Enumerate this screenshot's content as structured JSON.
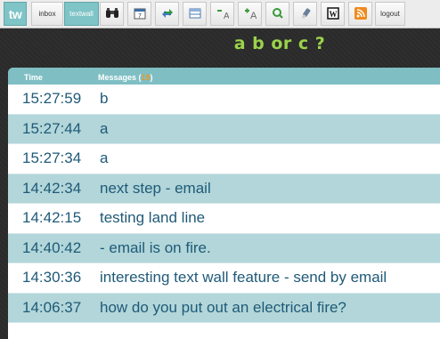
{
  "toolbar": {
    "logo": "tw",
    "inbox": "inbox",
    "textwall": "textwall",
    "logout": "logout",
    "icons": [
      "binoculars-icon",
      "calendar-icon",
      "refresh-icon",
      "table-icon",
      "font-down-icon",
      "font-up-icon",
      "zoom-icon",
      "usb-icon",
      "word-icon",
      "rss-icon"
    ]
  },
  "question": "a b or c ?",
  "table": {
    "col_time": "Time",
    "col_messages": "Messages (",
    "count": "19",
    "col_messages_close": ")",
    "rows": [
      {
        "time": "15:27:59",
        "message": "b"
      },
      {
        "time": "15:27:44",
        "message": "a"
      },
      {
        "time": "15:27:34",
        "message": "a"
      },
      {
        "time": "14:42:34",
        "message": "next step - email"
      },
      {
        "time": "14:42:15",
        "message": "testing land line"
      },
      {
        "time": "14:40:42",
        "message": "- email is on fire."
      },
      {
        "time": "14:30:36",
        "message": "interesting text wall feature - send by email"
      },
      {
        "time": "14:06:37",
        "message": "how do you put out an electrical fire?"
      }
    ]
  },
  "colors": {
    "accent": "#7fc4c6",
    "question": "#9bd34a",
    "row_alt": "#b2d6d9",
    "text": "#1f5a78",
    "count": "#e59a2c"
  }
}
